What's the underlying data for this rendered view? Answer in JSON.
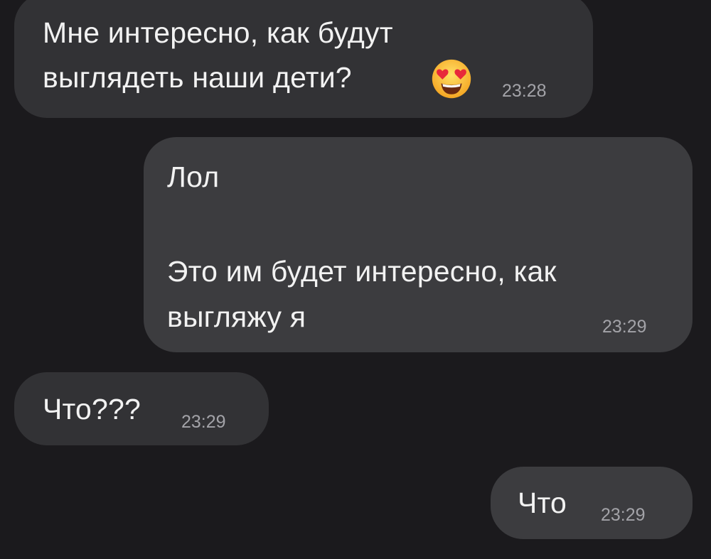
{
  "messages": [
    {
      "direction": "incoming",
      "lines": [
        "Мне интересно, как будут",
        "выглядеть наши дети?"
      ],
      "emoji": "smiling-face-with-heart-eyes",
      "time": "23:28"
    },
    {
      "direction": "outgoing",
      "lines": [
        "Лол",
        "",
        "Это им будет интересно, как",
        "выгляжу я"
      ],
      "time": "23:29"
    },
    {
      "direction": "incoming",
      "lines": [
        "Что???"
      ],
      "time": "23:29"
    },
    {
      "direction": "outgoing",
      "lines": [
        "Что"
      ],
      "time": "23:29"
    }
  ],
  "colors": {
    "background": "#1b1a1d",
    "incoming_bubble": "#323235",
    "outgoing_bubble": "#3c3c3f",
    "text": "#f2f2f2",
    "timestamp": "#a3a3a8"
  }
}
